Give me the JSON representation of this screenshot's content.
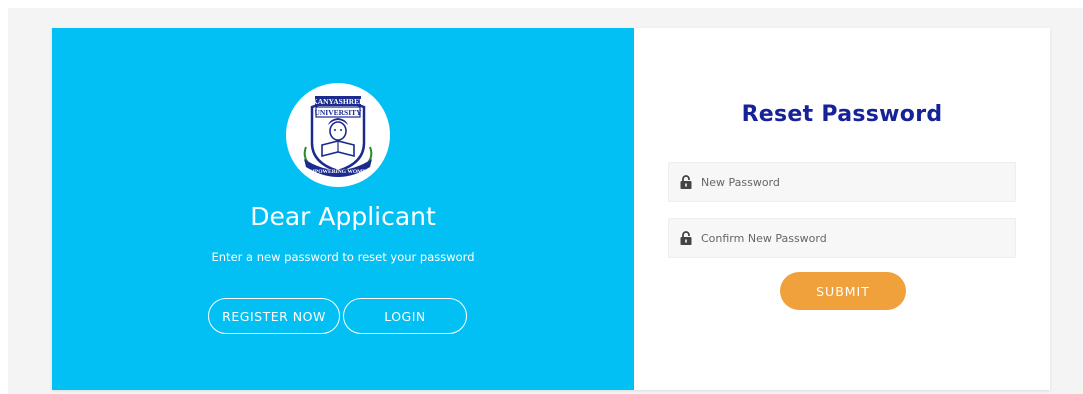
{
  "colors": {
    "left_panel": "#03c0f4",
    "title": "#162298",
    "submit": "#f0a13b"
  },
  "left": {
    "logo": {
      "name": "university-logo",
      "top_text": "KANYASHREE",
      "mid_text": "UNIVERSITY",
      "bottom_text": "EMPOWERING WOMEN"
    },
    "heading": "Dear Applicant",
    "subtext": "Enter a new password to reset your password",
    "buttons": {
      "register": "REGISTER NOW",
      "login": "LOGIN"
    }
  },
  "right": {
    "title": "Reset Password",
    "new_password": {
      "value": "",
      "placeholder": "New Password",
      "icon": "lock-icon"
    },
    "confirm_password": {
      "value": "",
      "placeholder": "Confirm New Password",
      "icon": "lock-icon"
    },
    "submit_label": "SUBMIT"
  }
}
